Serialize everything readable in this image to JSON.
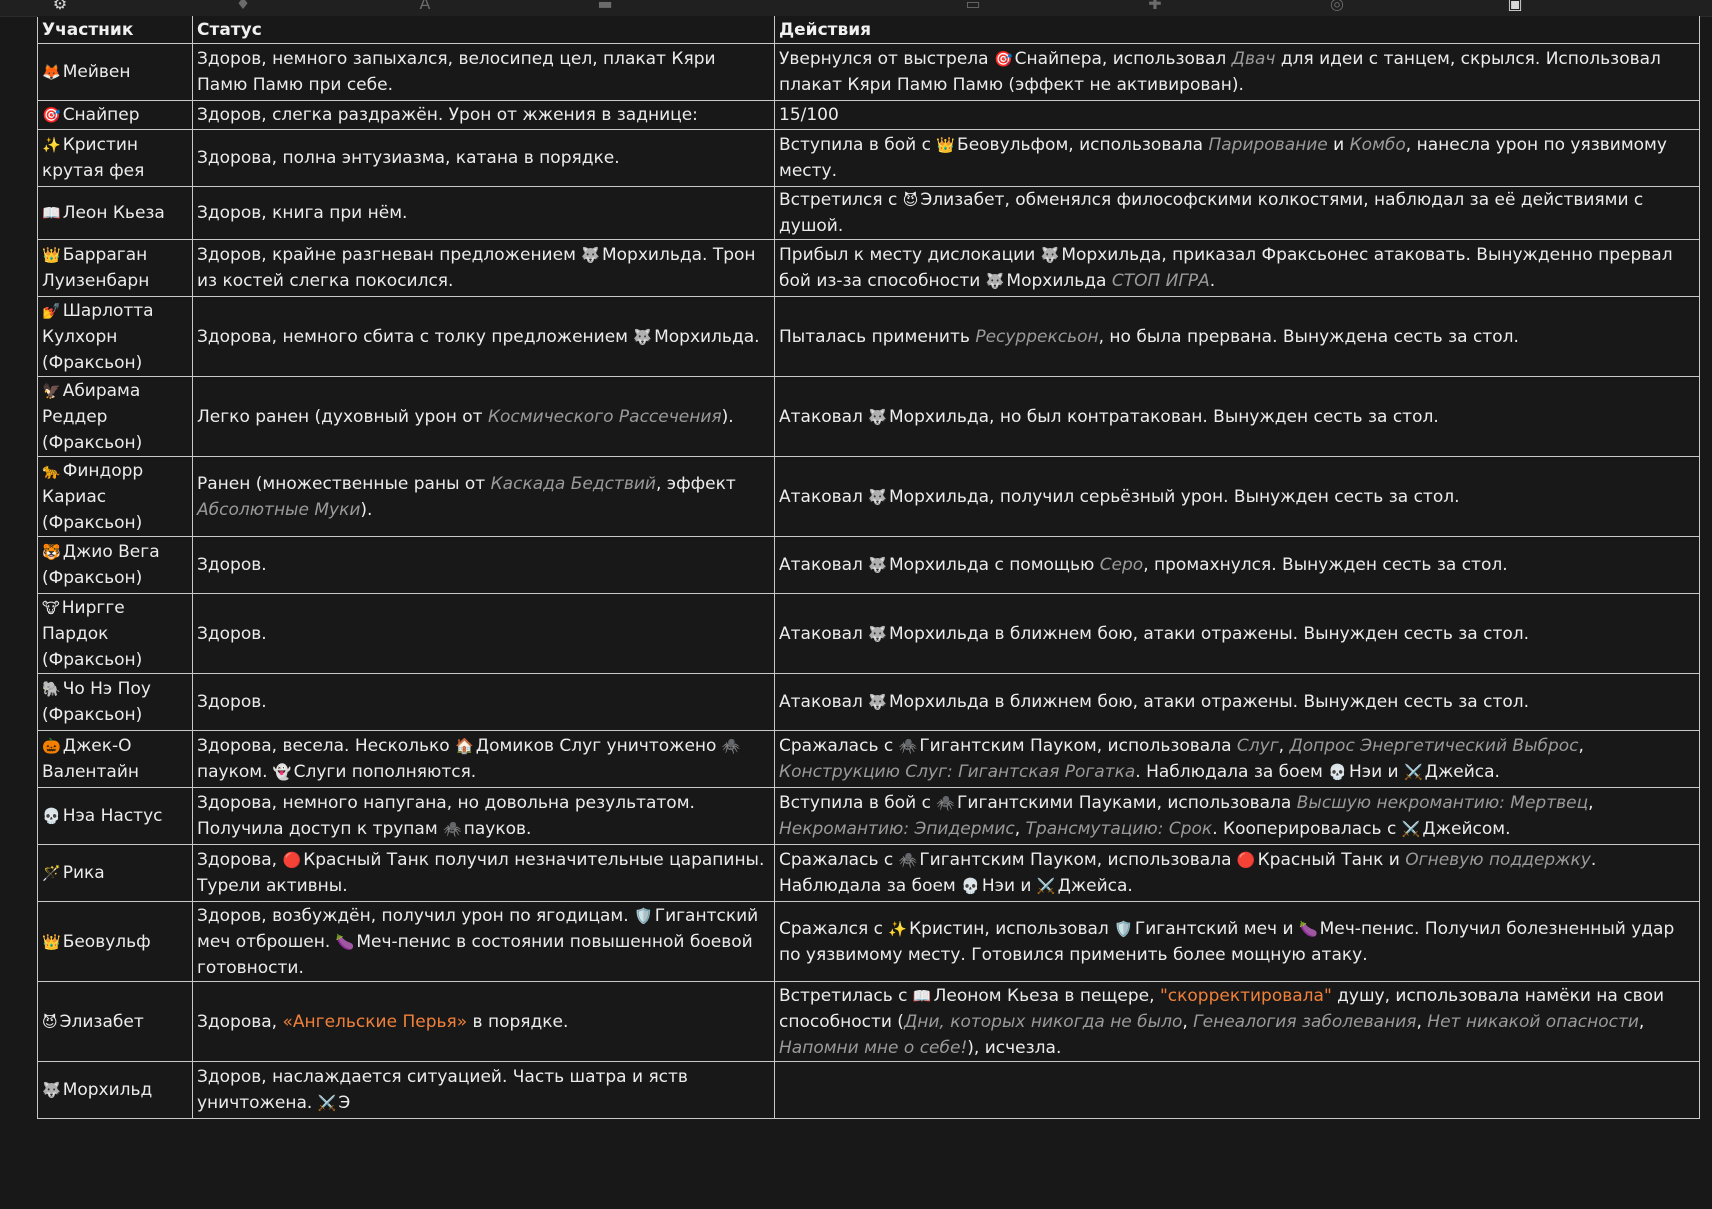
{
  "toolbar_icons": [
    "wrench-icon",
    "pin-icon",
    "font-icon",
    "archive-icon",
    "book-icon",
    "puzzle-icon",
    "smile-icon",
    "profile-card-icon"
  ],
  "columns": [
    "Участник",
    "Статус",
    "Действия"
  ],
  "rows": [
    {
      "emoji": "🦊",
      "name": "Мейвен",
      "status": [
        {
          "t": "Здоров, немного запыхался, велосипед цел, плакат Кяри Памю Памю при себе."
        }
      ],
      "actions": [
        {
          "t": "Увернулся от выстрела "
        },
        {
          "t": "🎯",
          "s": "emo"
        },
        {
          "t": "Снайпера, использовал "
        },
        {
          "t": "Двач",
          "s": "it"
        },
        {
          "t": " для идеи с танцем, скрылся. Использовал плакат Кяри Памю Памю (эффект не активирован)."
        }
      ]
    },
    {
      "emoji": "🎯",
      "name": "Снайпер",
      "status": [
        {
          "t": "Здоров, слегка раздражён. Урон от жжения в заднице:"
        }
      ],
      "actions": [
        {
          "t": "15/100"
        }
      ]
    },
    {
      "emoji": "✨",
      "name": "Кристин крутая фея",
      "status": [
        {
          "t": "Здорова, полна энтузиазма, катана в порядке."
        }
      ],
      "actions": [
        {
          "t": "Вступила в бой с "
        },
        {
          "t": "👑",
          "s": "emo"
        },
        {
          "t": "Беовульфом, использовала "
        },
        {
          "t": "Парирование",
          "s": "it"
        },
        {
          "t": " и "
        },
        {
          "t": "Комбо",
          "s": "it"
        },
        {
          "t": ", нанесла урон по уязвимому месту."
        }
      ]
    },
    {
      "emoji": "📖",
      "name": "Леон Кьеза",
      "status": [
        {
          "t": "Здоров, книга при нём."
        }
      ],
      "actions": [
        {
          "t": "Встретился с "
        },
        {
          "t": "😈",
          "s": "emo"
        },
        {
          "t": "Элизабет, обменялся философскими колкостями, наблюдал за её действиями с душой."
        }
      ]
    },
    {
      "emoji": "👑",
      "name": "Барраган Луизенбарн",
      "status": [
        {
          "t": "Здоров, крайне разгневан предложением "
        },
        {
          "t": "🐺",
          "s": "emo"
        },
        {
          "t": "Морхильда. Трон из костей слегка покосился."
        }
      ],
      "actions": [
        {
          "t": "Прибыл к месту дислокации "
        },
        {
          "t": "🐺",
          "s": "emo"
        },
        {
          "t": "Морхильда, приказал Фраксьонес атаковать. Вынужденно прервал бой из-за способности "
        },
        {
          "t": "🐺",
          "s": "emo"
        },
        {
          "t": "Морхильда "
        },
        {
          "t": "СТОП ИГРА",
          "s": "it"
        },
        {
          "t": "."
        }
      ]
    },
    {
      "emoji": "💅",
      "name": "Шарлотта Кулхорн (Фраксьон)",
      "status": [
        {
          "t": "Здорова, немного сбита с толку предложением "
        },
        {
          "t": "🐺",
          "s": "emo"
        },
        {
          "t": "Морхильда."
        }
      ],
      "actions": [
        {
          "t": "Пыталась применить "
        },
        {
          "t": "Ресуррексьон",
          "s": "it"
        },
        {
          "t": ", но была прервана. Вынуждена сесть за стол."
        }
      ]
    },
    {
      "emoji": "🦅",
      "name": "Абирама Реддер (Фраксьон)",
      "status": [
        {
          "t": "Легко ранен (духовный урон от "
        },
        {
          "t": "Космического Рассечения",
          "s": "it"
        },
        {
          "t": ")."
        }
      ],
      "actions": [
        {
          "t": "Атаковал "
        },
        {
          "t": "🐺",
          "s": "emo"
        },
        {
          "t": "Морхильда, но был контратакован. Вынужден сесть за стол."
        }
      ]
    },
    {
      "emoji": "🐆",
      "name": "Финдорр Кариас (Фраксьон)",
      "status": [
        {
          "t": "Ранен (множественные раны от "
        },
        {
          "t": "Каскада Бедствий",
          "s": "it"
        },
        {
          "t": ", эффект "
        },
        {
          "t": "Абсолютные Муки",
          "s": "it"
        },
        {
          "t": ")."
        }
      ],
      "actions": [
        {
          "t": "Атаковал "
        },
        {
          "t": "🐺",
          "s": "emo"
        },
        {
          "t": "Морхильда, получил серьёзный урон. Вынужден сесть за стол."
        }
      ]
    },
    {
      "emoji": "🐯",
      "name": "Джио Вега (Фраксьон)",
      "status": [
        {
          "t": "Здоров."
        }
      ],
      "actions": [
        {
          "t": "Атаковал "
        },
        {
          "t": "🐺",
          "s": "emo"
        },
        {
          "t": "Морхильда с помощью "
        },
        {
          "t": "Серо",
          "s": "it"
        },
        {
          "t": ", промахнулся. Вынужден сесть за стол."
        }
      ]
    },
    {
      "emoji": "🐮",
      "name": "Ниргге Пардок (Фраксьон)",
      "status": [
        {
          "t": "Здоров."
        }
      ],
      "actions": [
        {
          "t": "Атаковал "
        },
        {
          "t": "🐺",
          "s": "emo"
        },
        {
          "t": "Морхильда в ближнем бою, атаки отражены. Вынужден сесть за стол."
        }
      ]
    },
    {
      "emoji": "🐘",
      "name": "Чо Нэ Поу (Фраксьон)",
      "status": [
        {
          "t": "Здоров."
        }
      ],
      "actions": [
        {
          "t": "Атаковал "
        },
        {
          "t": "🐺",
          "s": "emo"
        },
        {
          "t": "Морхильда в ближнем бою, атаки отражены. Вынужден сесть за стол."
        }
      ]
    },
    {
      "emoji": "🎃",
      "name": "Джек-О Валентайн",
      "status": [
        {
          "t": "Здорова, весела. Несколько "
        },
        {
          "t": "🏠",
          "s": "emo"
        },
        {
          "t": "Домиков Слуг уничтожено "
        },
        {
          "t": "🕷️",
          "s": "emo"
        },
        {
          "t": "пауком. "
        },
        {
          "t": "👻",
          "s": "emo"
        },
        {
          "t": "Слуги пополняются."
        }
      ],
      "actions": [
        {
          "t": "Сражалась с "
        },
        {
          "t": "🕷️",
          "s": "emo"
        },
        {
          "t": "Гигантским Пауком, использовала "
        },
        {
          "t": "Слуг",
          "s": "it"
        },
        {
          "t": ", "
        },
        {
          "t": "Допрос Энергетический Выброс",
          "s": "it"
        },
        {
          "t": ", "
        },
        {
          "t": "Конструкцию Слуг: Гигантская Рогатка",
          "s": "it"
        },
        {
          "t": ". Наблюдала за боем "
        },
        {
          "t": "💀",
          "s": "emo"
        },
        {
          "t": "Нэи и "
        },
        {
          "t": "⚔️",
          "s": "emo"
        },
        {
          "t": "Джейса."
        }
      ]
    },
    {
      "emoji": "💀",
      "name": "Нэа Настус",
      "status": [
        {
          "t": "Здорова, немного напугана, но довольна результатом. Получила доступ к трупам "
        },
        {
          "t": "🕷️",
          "s": "emo"
        },
        {
          "t": "пауков."
        }
      ],
      "actions": [
        {
          "t": "Вступила в бой с "
        },
        {
          "t": "🕷️",
          "s": "emo"
        },
        {
          "t": "Гигантскими Пауками, использовала "
        },
        {
          "t": "Высшую некромантию: Мертвец",
          "s": "it"
        },
        {
          "t": ", "
        },
        {
          "t": "Некромантию: Эпидермис",
          "s": "it"
        },
        {
          "t": ", "
        },
        {
          "t": "Трансмутацию: Срок",
          "s": "it"
        },
        {
          "t": ". Кооперировалась с "
        },
        {
          "t": "⚔️",
          "s": "emo"
        },
        {
          "t": "Джейсом."
        }
      ]
    },
    {
      "emoji": "🪄",
      "name": "Рика",
      "status": [
        {
          "t": "Здорова, "
        },
        {
          "t": "🔴",
          "s": "emo"
        },
        {
          "t": "Красный Танк получил незначительные царапины. Турели активны."
        }
      ],
      "actions": [
        {
          "t": "Сражалась с "
        },
        {
          "t": "🕷️",
          "s": "emo"
        },
        {
          "t": "Гигантским Пауком, использовала "
        },
        {
          "t": "🔴",
          "s": "emo"
        },
        {
          "t": "Красный Танк и "
        },
        {
          "t": "Огневую поддержку",
          "s": "it"
        },
        {
          "t": ". Наблюдала за боем "
        },
        {
          "t": "💀",
          "s": "emo"
        },
        {
          "t": "Нэи и "
        },
        {
          "t": "⚔️",
          "s": "emo"
        },
        {
          "t": "Джейса."
        }
      ]
    },
    {
      "emoji": "👑",
      "name": "Беовульф",
      "status": [
        {
          "t": "Здоров, возбуждён, получил урон по ягодицам. "
        },
        {
          "t": "🛡️",
          "s": "emo"
        },
        {
          "t": "Гигантский меч отброшен. "
        },
        {
          "t": "🍆",
          "s": "emo"
        },
        {
          "t": "Меч-пенис в состоянии повышенной боевой готовности."
        }
      ],
      "actions": [
        {
          "t": "Сражался с "
        },
        {
          "t": "✨",
          "s": "emo"
        },
        {
          "t": "Кристин, использовал "
        },
        {
          "t": "🛡️",
          "s": "emo"
        },
        {
          "t": "Гигантский меч и "
        },
        {
          "t": "🍆",
          "s": "emo"
        },
        {
          "t": "Меч-пенис. Получил болезненный удар по уязвимому месту. Готовился применить более мощную атаку."
        }
      ]
    },
    {
      "emoji": "😈",
      "name": "Элизабет",
      "status": [
        {
          "t": "Здорова, "
        },
        {
          "t": "«Ангельские Перья»",
          "s": "or"
        },
        {
          "t": " в порядке."
        }
      ],
      "actions": [
        {
          "t": "Встретилась с "
        },
        {
          "t": "📖",
          "s": "emo"
        },
        {
          "t": "Леоном Кьеза в пещере, "
        },
        {
          "t": "\"скорректировала\"",
          "s": "or"
        },
        {
          "t": " душу, использовала намёки на свои способности ("
        },
        {
          "t": "Дни, которых никогда не было",
          "s": "it"
        },
        {
          "t": ", "
        },
        {
          "t": "Генеалогия заболевания",
          "s": "it"
        },
        {
          "t": ", "
        },
        {
          "t": "Нет никакой опасности",
          "s": "it"
        },
        {
          "t": ", "
        },
        {
          "t": "Напомни мне о себе!",
          "s": "it"
        },
        {
          "t": "), исчезла."
        }
      ]
    },
    {
      "emoji": "🐺",
      "name": "Морхильд",
      "status": [
        {
          "t": "Здоров, наслаждается ситуацией. Часть шатра и яств уничтожена. "
        },
        {
          "t": "⚔️",
          "s": "emo"
        },
        {
          "t": "Э"
        }
      ],
      "actions": []
    }
  ]
}
